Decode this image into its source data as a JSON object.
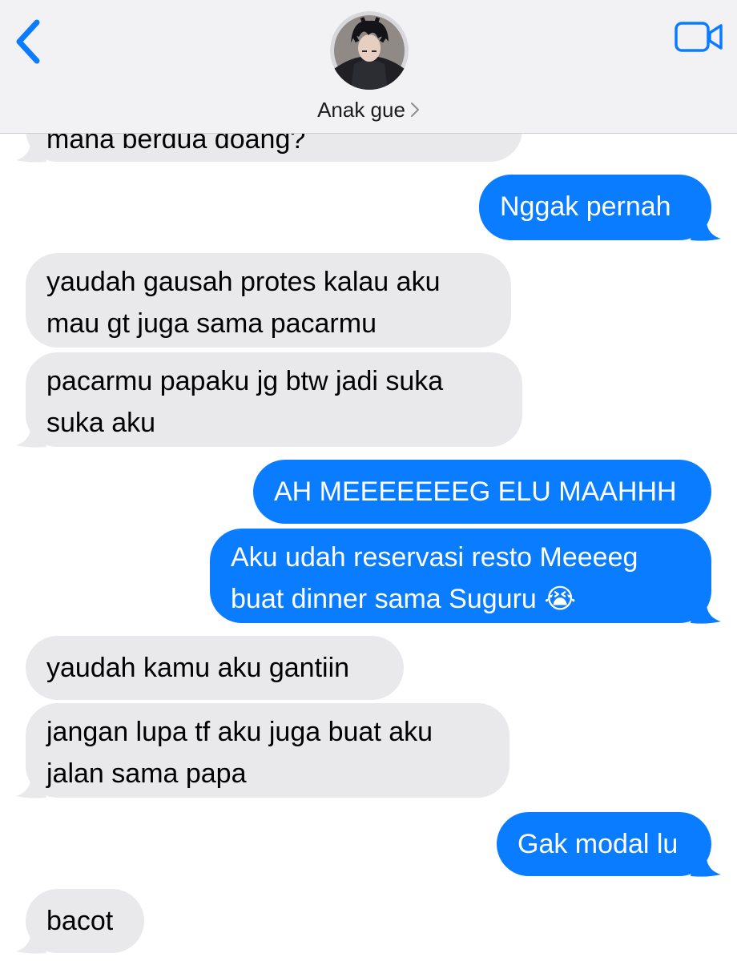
{
  "header": {
    "contact_name": "Anak gue",
    "back_icon": "chevron-left-icon",
    "video_icon": "video-camera-icon",
    "accent": "#0a7cff"
  },
  "messages": [
    {
      "direction": "incoming",
      "text": "mana berdua doang?"
    },
    {
      "direction": "outgoing",
      "text": "Nggak pernah"
    },
    {
      "direction": "incoming",
      "lines": [
        "yaudah gausah protes kalau aku",
        "mau gt juga sama pacarmu"
      ]
    },
    {
      "direction": "incoming",
      "lines": [
        "pacarmu papaku jg btw jadi suka",
        "suka aku"
      ]
    },
    {
      "direction": "outgoing",
      "text": "AH MEEEEEEEG ELU MAAHHH"
    },
    {
      "direction": "outgoing",
      "lines": [
        "Aku udah reservasi resto Meeeeg",
        "buat dinner sama Suguru 😭"
      ]
    },
    {
      "direction": "incoming",
      "text": "yaudah kamu aku gantiin"
    },
    {
      "direction": "incoming",
      "lines": [
        "jangan lupa tf aku juga buat aku",
        "jalan sama papa"
      ]
    },
    {
      "direction": "outgoing",
      "text": "Gak modal lu"
    },
    {
      "direction": "incoming",
      "text": "bacot"
    }
  ],
  "colors": {
    "incoming_bubble": "#e9e9eb",
    "outgoing_bubble": "#0a7cff",
    "header_bg": "#f2f2f4"
  }
}
